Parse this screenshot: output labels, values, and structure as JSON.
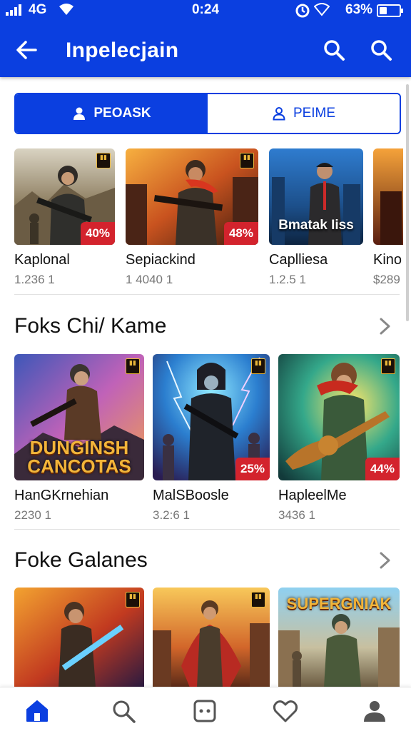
{
  "status_bar": {
    "network": "4G",
    "time": "0:24",
    "battery": "63%"
  },
  "app_bar": {
    "title": "Inpelecjain",
    "back_icon": "arrow-left-icon",
    "search_icon": "search-icon"
  },
  "segment": {
    "left_label": "PEOASK",
    "right_label": "PEIME",
    "left_icon": "person-icon",
    "right_icon": "person-outline-icon"
  },
  "featured": [
    {
      "title": "Kaplonal",
      "sub": "1.236  1",
      "badge": "40%",
      "overlay": ""
    },
    {
      "title": "Sepiackind",
      "sub": "1 4040  1",
      "badge": "48%",
      "overlay": ""
    },
    {
      "title": "Caplliesa",
      "sub": "1.2.5  1",
      "badge": "",
      "overlay": "Bmatak Iiss"
    },
    {
      "title": "Kino",
      "sub": "$289",
      "badge": "",
      "overlay": ""
    }
  ],
  "section1": {
    "title": "Foks Chi/ Kame",
    "items": [
      {
        "title": "HanGKrnehian",
        "sub": "2230  1",
        "badge": "",
        "overlay": "DUNGINSH CANCOTAS"
      },
      {
        "title": "MalSBoosle",
        "sub": "3.2:6  1",
        "badge": "25%",
        "overlay": ""
      },
      {
        "title": "HapleelMe",
        "sub": "3436  1",
        "badge": "44%",
        "overlay": ""
      }
    ]
  },
  "section2": {
    "title": "Foke Galanes",
    "items": [
      {
        "overlay": ""
      },
      {
        "overlay": ""
      },
      {
        "overlay": "SUPERGNIAK"
      }
    ]
  },
  "bottom_nav": [
    "home-icon",
    "search-icon",
    "game-icon",
    "heart-icon",
    "profile-icon"
  ],
  "colors": {
    "primary": "#0b3fe0",
    "badge": "#d3232d",
    "muted_text": "#777777"
  }
}
